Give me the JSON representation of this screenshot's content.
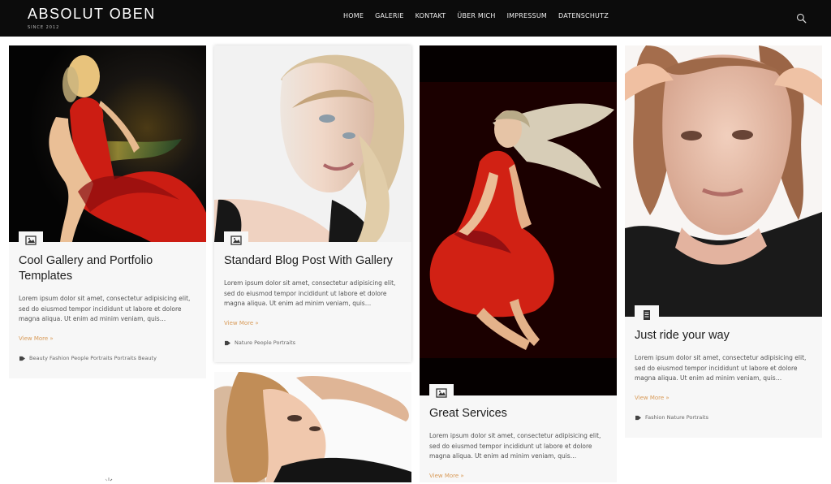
{
  "header": {
    "logo": "ABSOLUT OBEN",
    "tagline": "SINCE 2012",
    "nav": [
      "HOME",
      "GALERIE",
      "KONTAKT",
      "ÜBER MICH",
      "IMPRESSUM",
      "DATENSCHUTZ"
    ],
    "icon": "search-icon"
  },
  "cards": [
    {
      "title_line1": "Cool Gallery and Portfolio",
      "title_line2": "Templates",
      "excerpt_line1": "Lorem ipsum dolor sit amet, consectetur adipisicing elit,",
      "excerpt_line2": "sed do eiusmod tempor incididunt ut labore et dolore",
      "excerpt_line3": "magna aliqua. Ut enim ad minim veniam, quis…",
      "more": "View More »",
      "tags": "Beauty Fashion People Portraits Portraits Beauty",
      "icon": "image-icon"
    },
    {
      "title": "Standard Blog Post With Gallery",
      "excerpt_line1": "Lorem ipsum dolor sit amet, consectetur adipisicing elit,",
      "excerpt_line2": "sed do eiusmod tempor incididunt ut labore et dolore",
      "excerpt_line3": "magna aliqua. Ut enim ad minim veniam, quis…",
      "more": "View More »",
      "tags": "Nature People Portraits",
      "icon": "image-icon"
    },
    {
      "title": "Great Services",
      "excerpt_line1": "Lorem ipsum dolor sit amet, consectetur adipisicing elit,",
      "excerpt_line2": "sed do eiusmod tempor incididunt ut labore et dolore",
      "excerpt_line3": "magna aliqua. Ut enim ad minim veniam, quis…",
      "more": "View More »",
      "icon": "image-icon"
    },
    {
      "title": "Just ride your way",
      "excerpt_line1": "Lorem ipsum dolor sit amet, consectetur adipisicing elit,",
      "excerpt_line2": "sed do eiusmod tempor incididunt ut labore et dolore",
      "excerpt_line3": "magna aliqua. Ut enim ad minim veniam, quis…",
      "more": "View More »",
      "tags": "Fashion Nature Portraits",
      "icon": "document-icon"
    }
  ]
}
